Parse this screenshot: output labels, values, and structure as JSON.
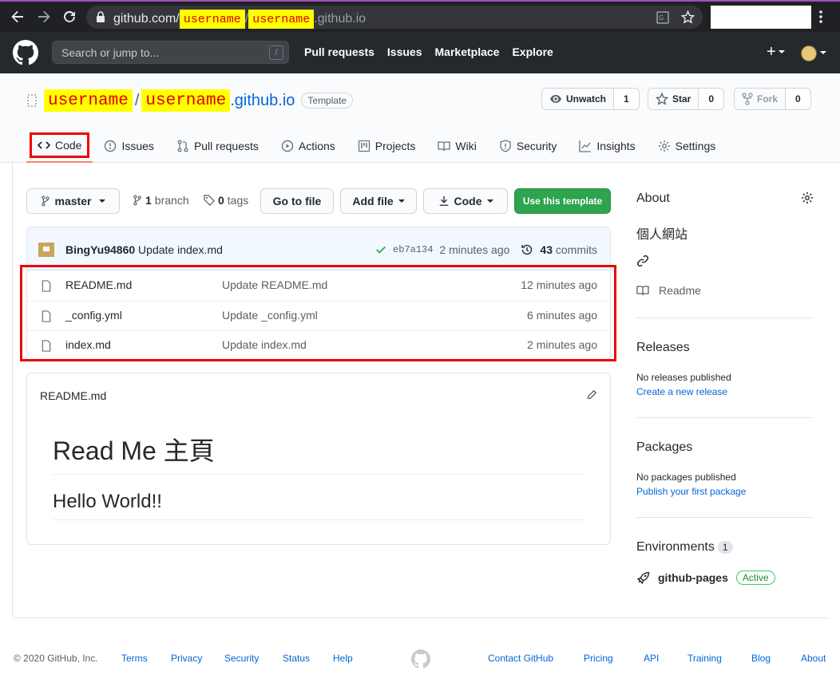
{
  "browser": {
    "url_prefix": "github.com/",
    "url_user1": "username",
    "url_sep": "/",
    "url_user2": "username",
    "url_suffix": ".github.io"
  },
  "header": {
    "search_placeholder": "Search or jump to...",
    "search_key": "/",
    "nav": [
      "Pull requests",
      "Issues",
      "Marketplace",
      "Explore"
    ],
    "plus": "+"
  },
  "repo": {
    "owner": "username",
    "sep": "/",
    "name_hl": "username",
    "name_rest": ".github.io",
    "template_badge": "Template",
    "watch_label": "Unwatch",
    "watch_count": "1",
    "star_label": "Star",
    "star_count": "0",
    "fork_label": "Fork",
    "fork_count": "0"
  },
  "tabs": {
    "code": "Code",
    "issues": "Issues",
    "pulls": "Pull requests",
    "actions": "Actions",
    "projects": "Projects",
    "wiki": "Wiki",
    "security": "Security",
    "insights": "Insights",
    "settings": "Settings"
  },
  "toolbar": {
    "branch": "master",
    "branch_count": "1",
    "branch_word": "branch",
    "tag_count": "0",
    "tag_word": "tags",
    "goto": "Go to file",
    "add": "Add file",
    "code": "Code",
    "template": "Use this template"
  },
  "commit": {
    "author": "BingYu94860",
    "message": "Update index.md",
    "sha": "eb7a134",
    "time": "2 minutes ago",
    "count": "43",
    "count_word": "commits"
  },
  "files": [
    {
      "name": "README.md",
      "message": "Update README.md",
      "time": "12 minutes ago"
    },
    {
      "name": "_config.yml",
      "message": "Update _config.yml",
      "time": "6 minutes ago"
    },
    {
      "name": "index.md",
      "message": "Update index.md",
      "time": "2 minutes ago"
    }
  ],
  "readme": {
    "filename": "README.md",
    "h1": "Read Me 主頁",
    "h2": "Hello World!!"
  },
  "sidebar": {
    "about": "About",
    "description": "個人網站",
    "readme": "Readme",
    "releases": "Releases",
    "releases_none": "No releases published",
    "releases_link": "Create a new release",
    "packages": "Packages",
    "packages_none": "No packages published",
    "packages_link": "Publish your first package",
    "environments": "Environments",
    "env_count": "1",
    "env_name": "github-pages",
    "env_status": "Active"
  },
  "footer": {
    "copyright": "© 2020 GitHub, Inc.",
    "left_links": [
      "Terms",
      "Privacy",
      "Security",
      "Status",
      "Help"
    ],
    "right_links": [
      "Contact GitHub",
      "Pricing",
      "API",
      "Training",
      "Blog",
      "About"
    ]
  },
  "colors": {
    "highlight_bg": "#ffff00",
    "highlight_text": "#e00000",
    "annotation_red": "#e00000",
    "primary_green": "#2ea44f",
    "link_blue": "#0366d6"
  }
}
